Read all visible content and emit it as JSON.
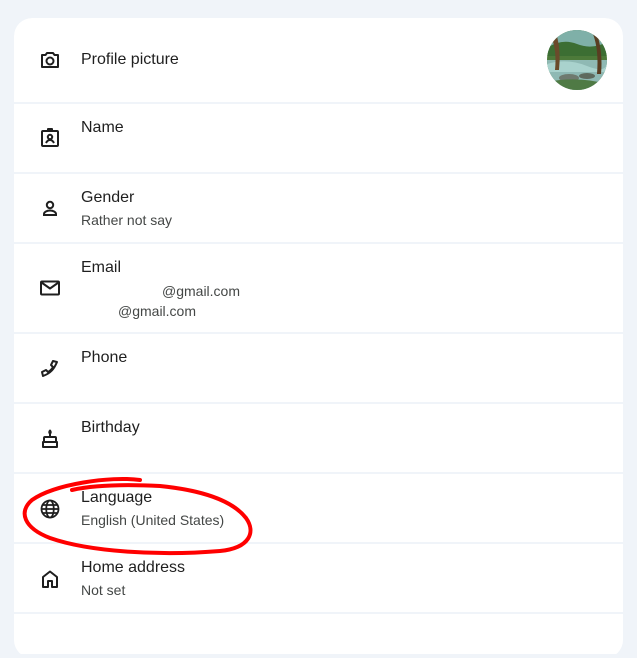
{
  "rows": {
    "profile_picture": {
      "label": "Profile picture",
      "icon": "camera-icon"
    },
    "name": {
      "label": "Name",
      "icon": "badge-icon"
    },
    "gender": {
      "label": "Gender",
      "value": "Rather not say",
      "icon": "person-icon"
    },
    "email": {
      "label": "Email",
      "values": [
        "@gmail.com",
        "@gmail.com"
      ],
      "icon": "mail-icon"
    },
    "phone": {
      "label": "Phone",
      "icon": "phone-icon"
    },
    "birthday": {
      "label": "Birthday",
      "icon": "cake-icon"
    },
    "language": {
      "label": "Language",
      "value": "English (United States)",
      "icon": "globe-icon"
    },
    "home_address": {
      "label": "Home address",
      "value": "Not set",
      "icon": "home-icon"
    }
  },
  "colors": {
    "page_bg": "#f0f4f9",
    "row_bg": "#ffffff",
    "text_primary": "#1f1f1f",
    "text_secondary": "#444746",
    "annotation": "#ff0000"
  }
}
